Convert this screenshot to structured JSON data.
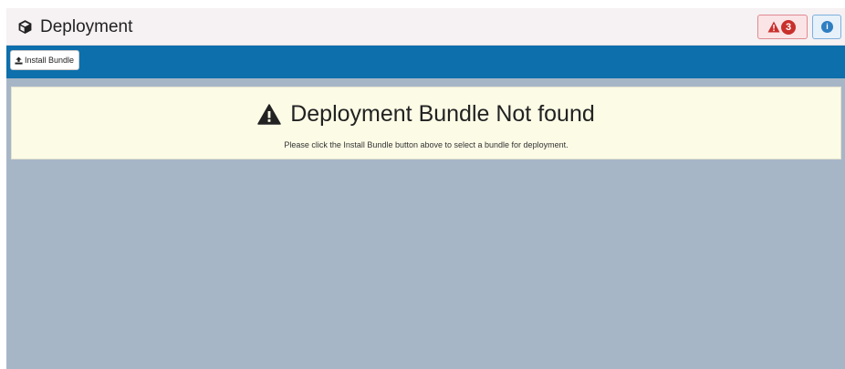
{
  "header": {
    "title": "Deployment",
    "alerts_count": "3",
    "info_label": "i"
  },
  "toolbar": {
    "install_label": "Install Bundle"
  },
  "notice": {
    "heading": "Deployment Bundle Not found",
    "message": "Please click the Install Bundle button above to select a bundle for deployment."
  },
  "colors": {
    "toolbar_bg": "#0d6fab",
    "content_bg": "#a7b6c7",
    "notice_bg": "#fcfbe6",
    "alert_badge": "#c9302c",
    "info_accent": "#2f7fc1"
  },
  "icons": {
    "title": "cube-icon",
    "alert": "warning-icon",
    "info": "info-icon",
    "install": "upload-icon",
    "notice": "warning-icon"
  }
}
